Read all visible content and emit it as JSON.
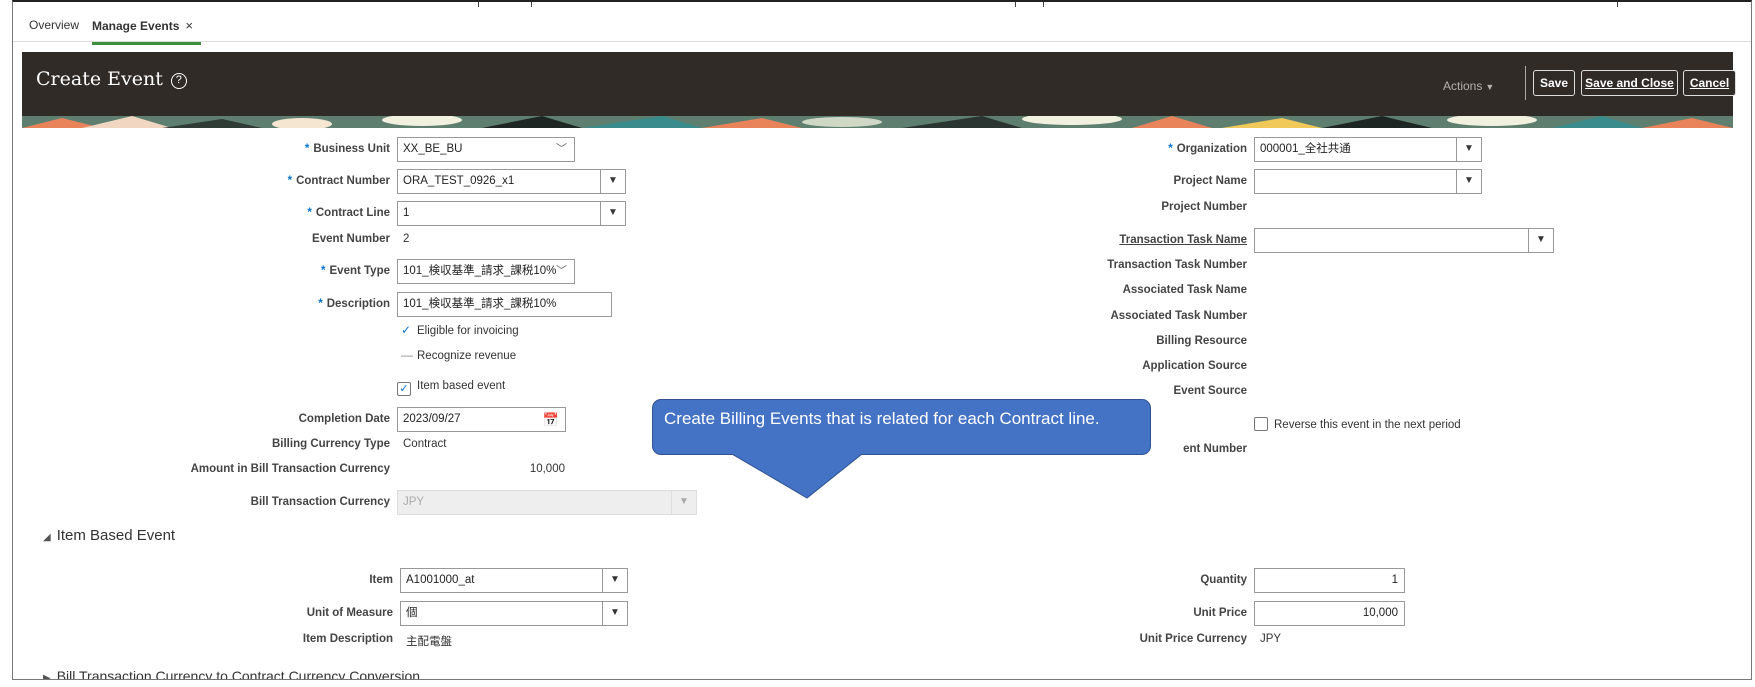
{
  "tabs": [
    {
      "label": "Overview"
    },
    {
      "label": "Manage Events",
      "close": "×"
    }
  ],
  "header": {
    "title": "Create Event",
    "help": "?",
    "actions_label": "Actions",
    "save_label": "Save",
    "save_close_label": "Save and Close",
    "cancel_label": "Cancel",
    "panel_color": "#302b27"
  },
  "form_left": {
    "business_unit_label": "Business Unit",
    "business_unit_value": "XX_BE_BU",
    "contract_number_label": "Contract Number",
    "contract_number_value": "ORA_TEST_0926_x1",
    "contract_line_label": "Contract Line",
    "contract_line_value": "1",
    "event_number_label": "Event Number",
    "event_number_value": "2",
    "event_type_label": "Event Type",
    "event_type_value": "101_検収基準_請求_課税10%",
    "description_label": "Description",
    "description_value": "101_検収基準_請求_課税10%",
    "eligible_invoicing_label": "Eligible for invoicing",
    "recognize_revenue_label": "Recognize revenue",
    "item_based_event_label": "Item based event",
    "completion_date_label": "Completion Date",
    "completion_date_value": "2023/09/27",
    "billing_currency_type_label": "Billing Currency Type",
    "billing_currency_type_value": "Contract",
    "amount_label": "Amount in Bill Transaction Currency",
    "amount_value": "10,000",
    "bill_txn_currency_label": "Bill Transaction Currency",
    "bill_txn_currency_value": "JPY"
  },
  "form_right": {
    "organization_label": "Organization",
    "organization_value": "000001_全社共通",
    "project_name_label": "Project Name",
    "project_name_value": "",
    "project_number_label": "Project Number",
    "transaction_task_name_label": "Transaction Task Name",
    "transaction_task_name_value": "",
    "transaction_task_number_label": "Transaction Task Number",
    "associated_task_name_label": "Associated Task Name",
    "associated_task_number_label": "Associated Task Number",
    "billing_resource_label": "Billing Resource",
    "application_source_label": "Application Source",
    "event_source_label": "Event Source",
    "reverse_event_label": "Reverse this event in the next period",
    "partial_label": "ent Number"
  },
  "item_section": {
    "title": "Item Based Event",
    "item_label": "Item",
    "item_value": "A1001000_at",
    "uom_label": "Unit of Measure",
    "uom_value": "個",
    "item_desc_label": "Item Description",
    "item_desc_value": "主配電盤",
    "quantity_label": "Quantity",
    "quantity_value": "1",
    "unit_price_label": "Unit Price",
    "unit_price_value": "10,000",
    "unit_price_currency_label": "Unit Price Currency",
    "unit_price_currency_value": "JPY"
  },
  "next_section": {
    "title": "Bill Transaction Currency to Contract Currency Conversion"
  },
  "callout": {
    "text": "Create Billing Events that is related for each Contract line.",
    "color": "#4472c4"
  }
}
